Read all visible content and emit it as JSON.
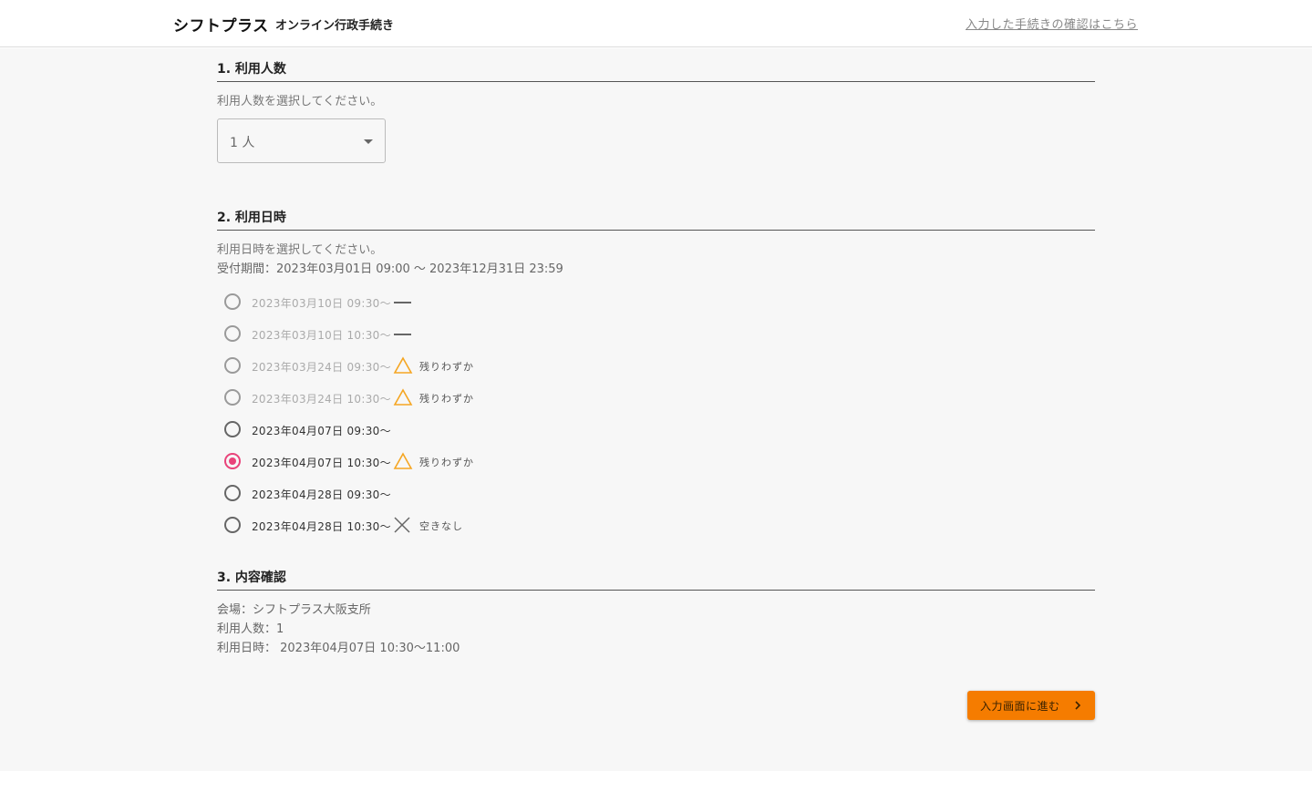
{
  "header": {
    "brand": "シフトプラス",
    "subtitle": "オンライン行政手続き",
    "confirm_link": "入力した手続きの確認はこちら"
  },
  "section1": {
    "title": "1. 利用人数",
    "description": "利用人数を選択してください。",
    "select_value": "1 人"
  },
  "section2": {
    "title": "2. 利用日時",
    "description": "利用日時を選択してください。",
    "period": "受付期間：2023年03月01日 09:00 〜 2023年12月31日 23:59",
    "slots": [
      {
        "label": "2023年03月10日 09:30〜",
        "status": "closed",
        "status_label": "",
        "disabled": true,
        "checked": false
      },
      {
        "label": "2023年03月10日 10:30〜",
        "status": "closed",
        "status_label": "",
        "disabled": true,
        "checked": false
      },
      {
        "label": "2023年03月24日 09:30〜",
        "status": "few",
        "status_label": "残りわずか",
        "disabled": true,
        "checked": false
      },
      {
        "label": "2023年03月24日 10:30〜",
        "status": "few",
        "status_label": "残りわずか",
        "disabled": true,
        "checked": false
      },
      {
        "label": "2023年04月07日 09:30〜",
        "status": "available",
        "status_label": "",
        "disabled": false,
        "checked": false
      },
      {
        "label": "2023年04月07日 10:30〜",
        "status": "few",
        "status_label": "残りわずか",
        "disabled": false,
        "checked": true
      },
      {
        "label": "2023年04月28日 09:30〜",
        "status": "available",
        "status_label": "",
        "disabled": false,
        "checked": false
      },
      {
        "label": "2023年04月28日 10:30〜",
        "status": "full",
        "status_label": "空きなし",
        "disabled": false,
        "checked": false
      }
    ]
  },
  "section3": {
    "title": "3. 内容確認",
    "venue": "会場：シフトプラス大阪支所",
    "people": "利用人数：1",
    "datetime": "利用日時： 2023年04月07日 10:30〜11:00"
  },
  "actions": {
    "next_label": "入力画面に進む"
  },
  "colors": {
    "accent_radio": "#e9437a",
    "warning": "#f5a623",
    "button": "#f57c00"
  }
}
